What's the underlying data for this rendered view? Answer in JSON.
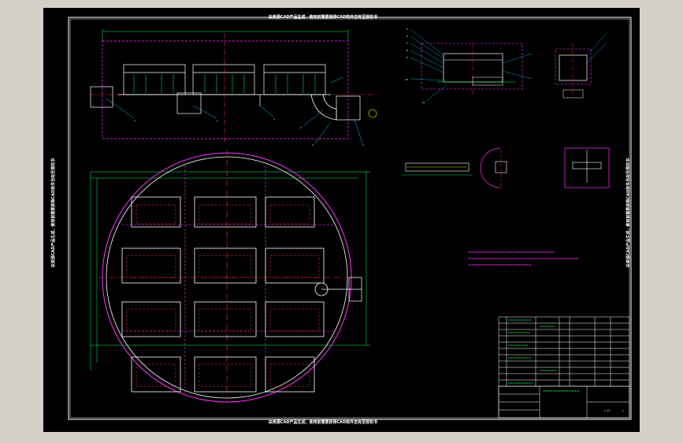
{
  "watermark": {
    "top": "由资源CAD产品生成，使用前需要获得CAD软件自有至授权书",
    "bottom": "由资源CAD产品生成，使用前需要获得CAD软件自有至授权书",
    "left": "由资源CAD产品生成，使用前需要获得CAD软件自有至授权书",
    "right": "由资源CAD产品生成，使用前需要获得CAD软件自有至授权书"
  },
  "callouts": {
    "top_view": [
      "1",
      "1",
      "1",
      "2",
      "3",
      "4"
    ],
    "section": [
      "5",
      "6",
      "7",
      "8",
      "9",
      "10",
      "11"
    ]
  },
  "title_block": {
    "drawing_no": "1-07",
    "sheet": "1"
  },
  "colors": {
    "background": "#000000",
    "frame": "#ffffff",
    "object": "#ffffff",
    "hidden": "#ff3333",
    "centerline": "#ff3333",
    "outline": "#ff33ff",
    "dimension": "#00ff66",
    "leader": "#00ccff",
    "table": "#ffffff"
  }
}
